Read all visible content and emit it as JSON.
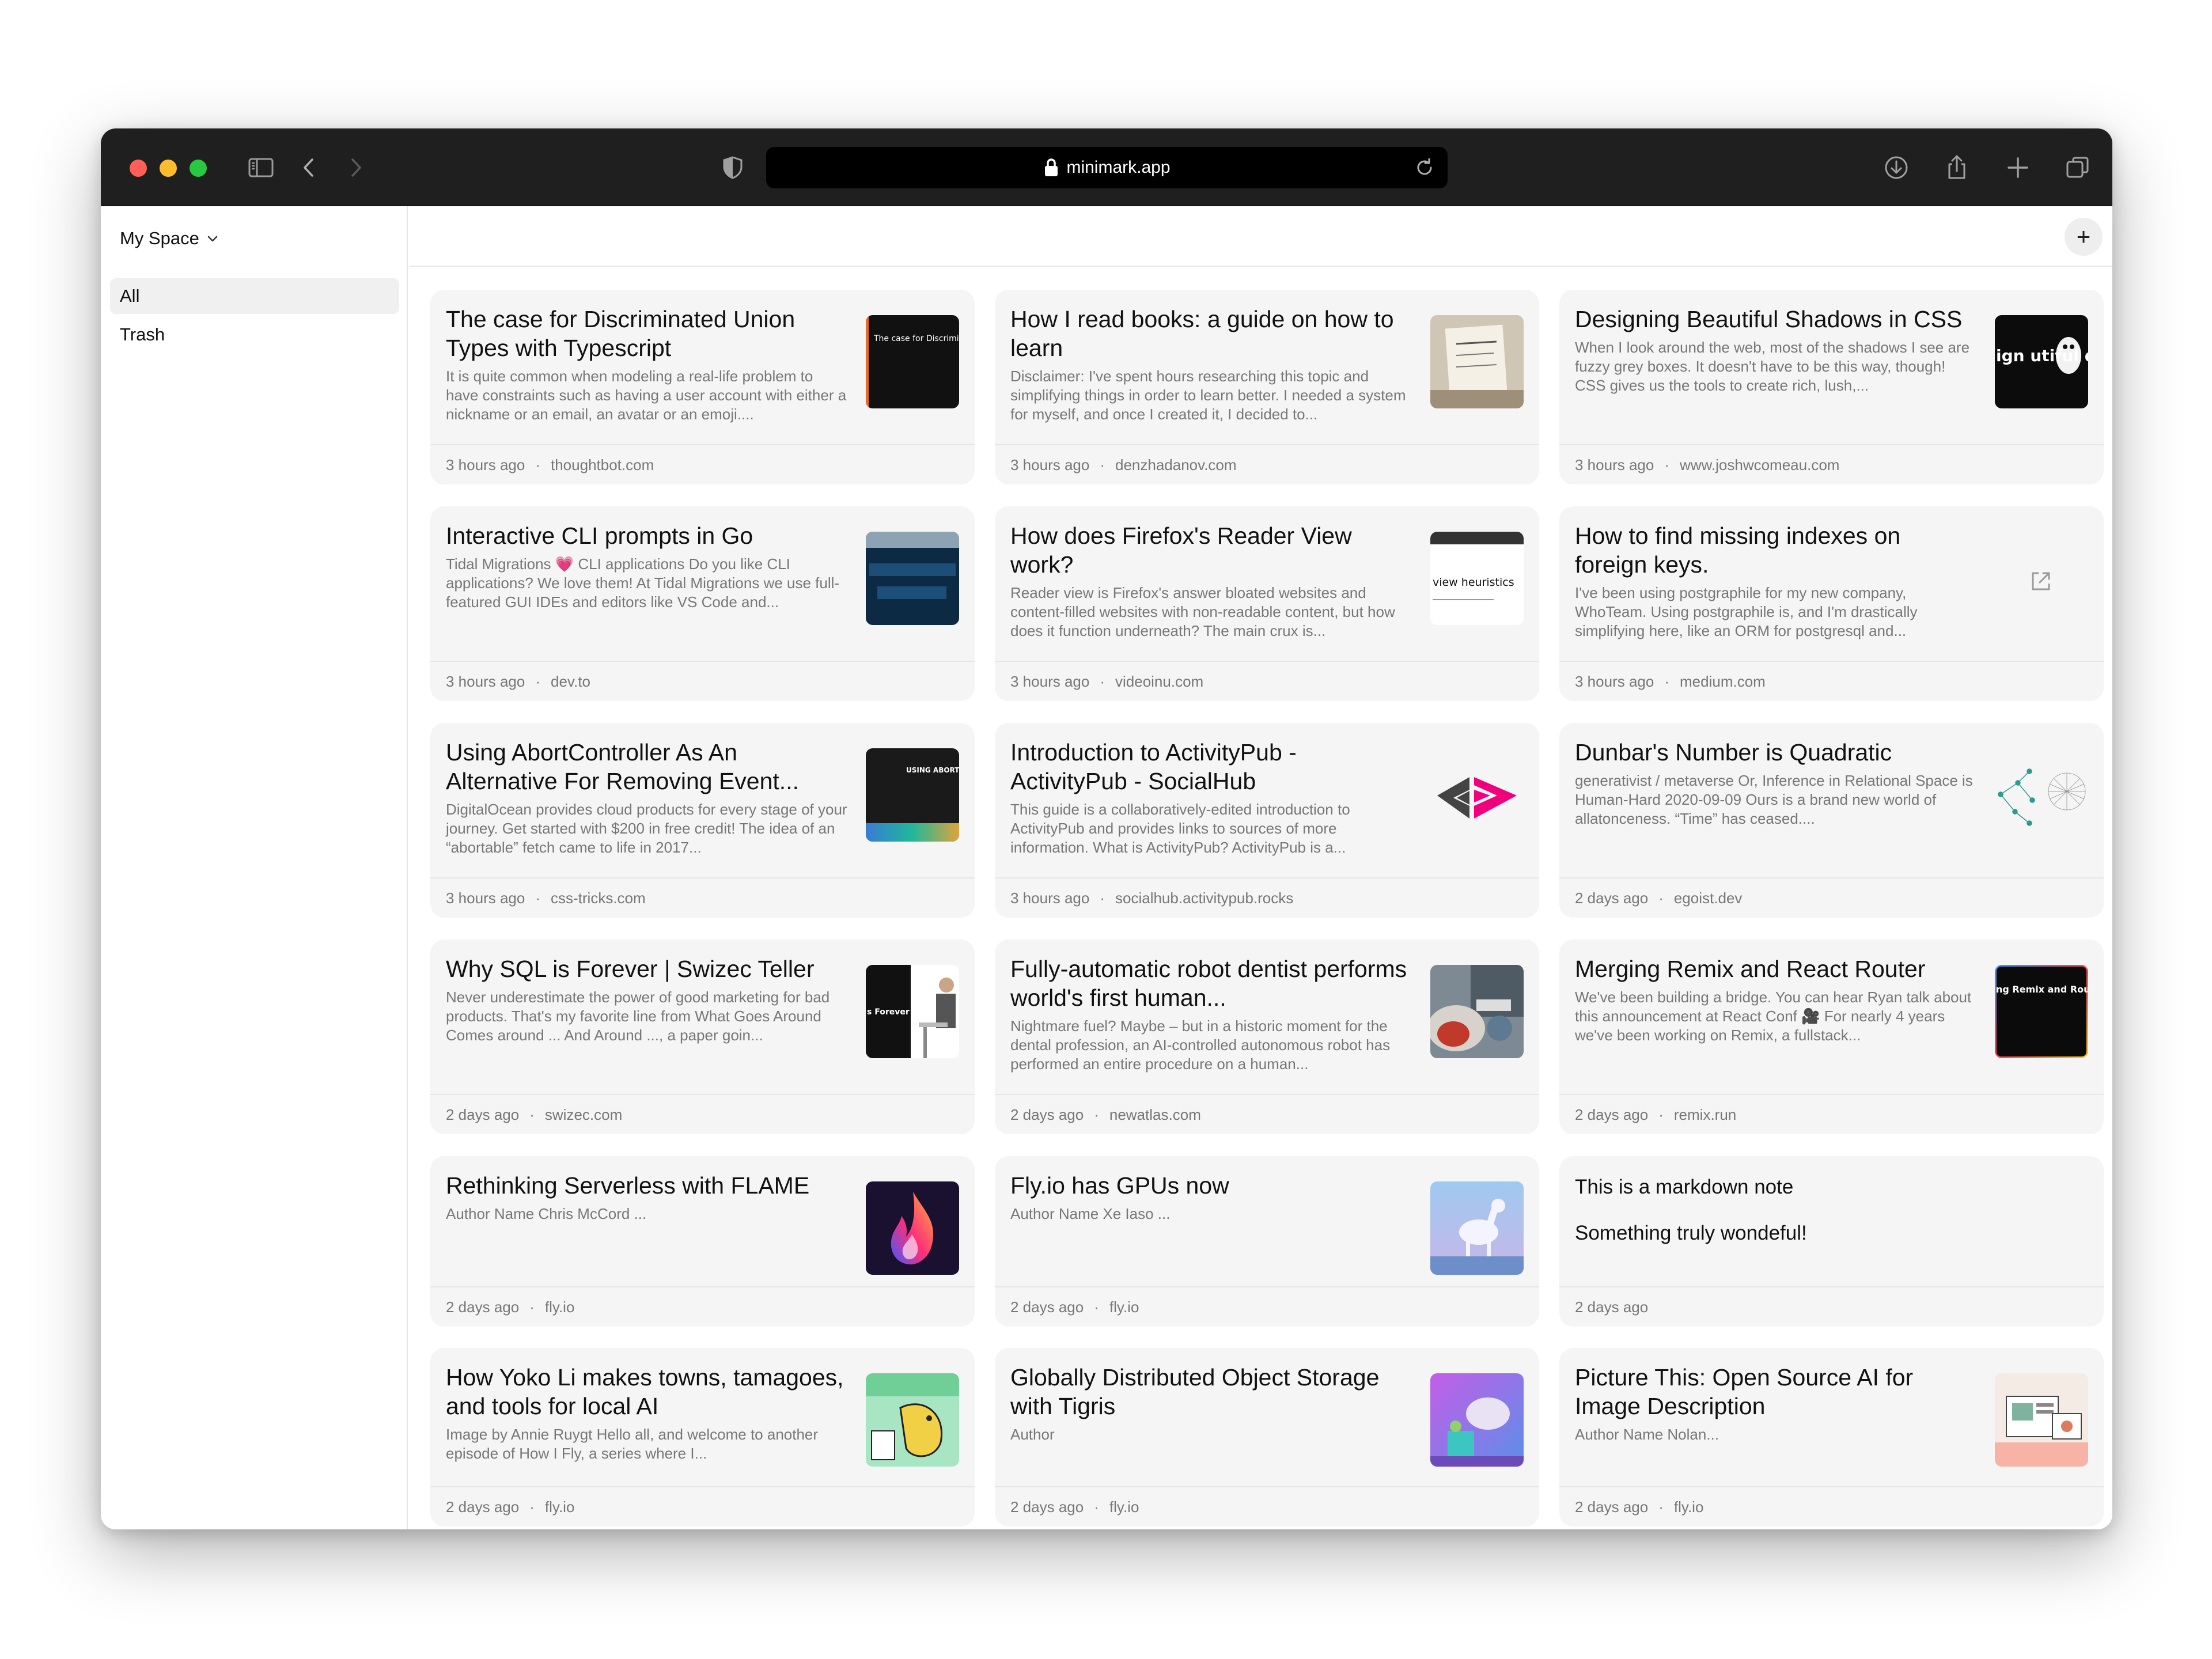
{
  "browser": {
    "url": "minimark.app"
  },
  "sidebar": {
    "space_name": "My Space",
    "items": [
      {
        "label": "All",
        "active": true
      },
      {
        "label": "Trash",
        "active": false
      }
    ]
  },
  "main": {
    "add_label": "+"
  },
  "cards": [
    {
      "title": "The case for Discriminated Union Types with Typescript",
      "excerpt": "It is quite common when modeling a real-life problem to have constraints such as having a user account with either a nickname or an email, an avatar or an emoji....",
      "time": "3 hours ago",
      "domain": "thoughtbot.com",
      "thumb_text": "The case for Discriminated Union Types with Typescript"
    },
    {
      "title": "How I read books: a guide on how to learn",
      "excerpt": "Disclaimer: I've spent hours researching this topic and simplifying things in order to learn better. I needed a system for myself, and once I created it, I decided to...",
      "time": "3 hours ago",
      "domain": "denzhadanov.com"
    },
    {
      "title": "Designing Beautiful Shadows in CSS",
      "excerpt": "When I look around the web, most of the shadows I see are fuzzy grey boxes. It doesn't have to be this way, though! CSS gives us the tools to create rich, lush,...",
      "time": "3 hours ago",
      "domain": "www.joshwcomeau.com",
      "thumb_text": "ign utiful dows"
    },
    {
      "title": "Interactive CLI prompts in Go",
      "excerpt": "Tidal Migrations 💗 CLI applications Do you like CLI applications? We love them! At Tidal Migrations we use full-featured GUI IDEs and editors like VS Code and...",
      "time": "3 hours ago",
      "domain": "dev.to"
    },
    {
      "title": "How does Firefox's Reader View work?",
      "excerpt": "Reader view is Firefox's answer bloated websites and content-filled websites with non-readable content, but how does it function underneath? The main crux is...",
      "time": "3 hours ago",
      "domain": "videoinu.com",
      "thumb_text": "view heuristics"
    },
    {
      "title": "How to find missing indexes on foreign keys.",
      "excerpt": "I've been using postgraphile for my new company, WhoTeam. Using postgraphile is, and I'm drastically simplifying here, like an ORM for postgresql and...",
      "time": "3 hours ago",
      "domain": "medium.com"
    },
    {
      "title": "Using AbortController As An Alternative For Removing Event...",
      "excerpt": "DigitalOcean provides cloud products for every stage of your journey. Get started with $200 in free credit! The idea of an “abortable” fetch came to life in 2017...",
      "time": "3 hours ago",
      "domain": "css-tricks.com",
      "thumb_text": "USING ABORTCO AS AN ALTERNA REMOVING EVEN LISTENERS"
    },
    {
      "title": "Introduction to ActivityPub - ActivityPub - SocialHub",
      "excerpt": "This guide is a collaboratively-edited introduction to ActivityPub and provides links to sources of more information. What is ActivityPub? ActivityPub is a...",
      "time": "3 hours ago",
      "domain": "socialhub.activitypub.rocks"
    },
    {
      "title": "Dunbar's Number is Quadratic",
      "excerpt": "generativist / metaverse Or, Inference in Relational Space is Human-Hard 2020-09-09 Ours is a brand new world of allatonceness. “Time” has ceased....",
      "time": "2 days ago",
      "domain": "egoist.dev"
    },
    {
      "title": "Why SQL is Forever | Swizec Teller",
      "excerpt": "Never underestimate the power of good marketing for bad products. That's my favorite line from What Goes Around Comes around ... And Around ..., a paper goin...",
      "time": "2 days ago",
      "domain": "swizec.com",
      "thumb_text": "s Forever"
    },
    {
      "title": "Fully-automatic robot dentist performs world's first human...",
      "excerpt": "Nightmare fuel? Maybe – but in a historic moment for the dental profession, an AI-controlled autonomous robot has performed an entire procedure on a human...",
      "time": "2 days ago",
      "domain": "newatlas.com"
    },
    {
      "title": "Merging Remix and React Router",
      "excerpt": "We've been building a bridge. You can hear Ryan talk about this announcement at React Conf 🎥 For nearly 4 years we've been working on Remix, a fullstack...",
      "time": "2 days ago",
      "domain": "remix.run",
      "thumb_text": "ng Remix and Router"
    },
    {
      "title": "Rethinking Serverless with FLAME",
      "excerpt": "Author Name Chris McCord ...",
      "time": "2 days ago",
      "domain": "fly.io"
    },
    {
      "title": "Fly.io has GPUs now",
      "excerpt": "Author Name Xe Iaso ...",
      "time": "2 days ago",
      "domain": "fly.io"
    },
    {
      "note_line1": "This is a markdown note",
      "note_line2": "Something truly wondeful!",
      "time": "2 days ago"
    },
    {
      "title": "How Yoko Li makes towns, tamagoes, and tools for local AI",
      "excerpt": "Image by Annie Ruygt Hello all, and welcome to another episode of How I Fly, a series where I...",
      "time": "2 days ago",
      "domain": "fly.io"
    },
    {
      "title": "Globally Distributed Object Storage with Tigris",
      "excerpt": "Author",
      "time": "2 days ago",
      "domain": "fly.io"
    },
    {
      "title": "Picture This: Open Source AI for Image Description",
      "excerpt": "Author Name Nolan...",
      "time": "2 days ago",
      "domain": "fly.io"
    }
  ],
  "footer_separator": "·"
}
